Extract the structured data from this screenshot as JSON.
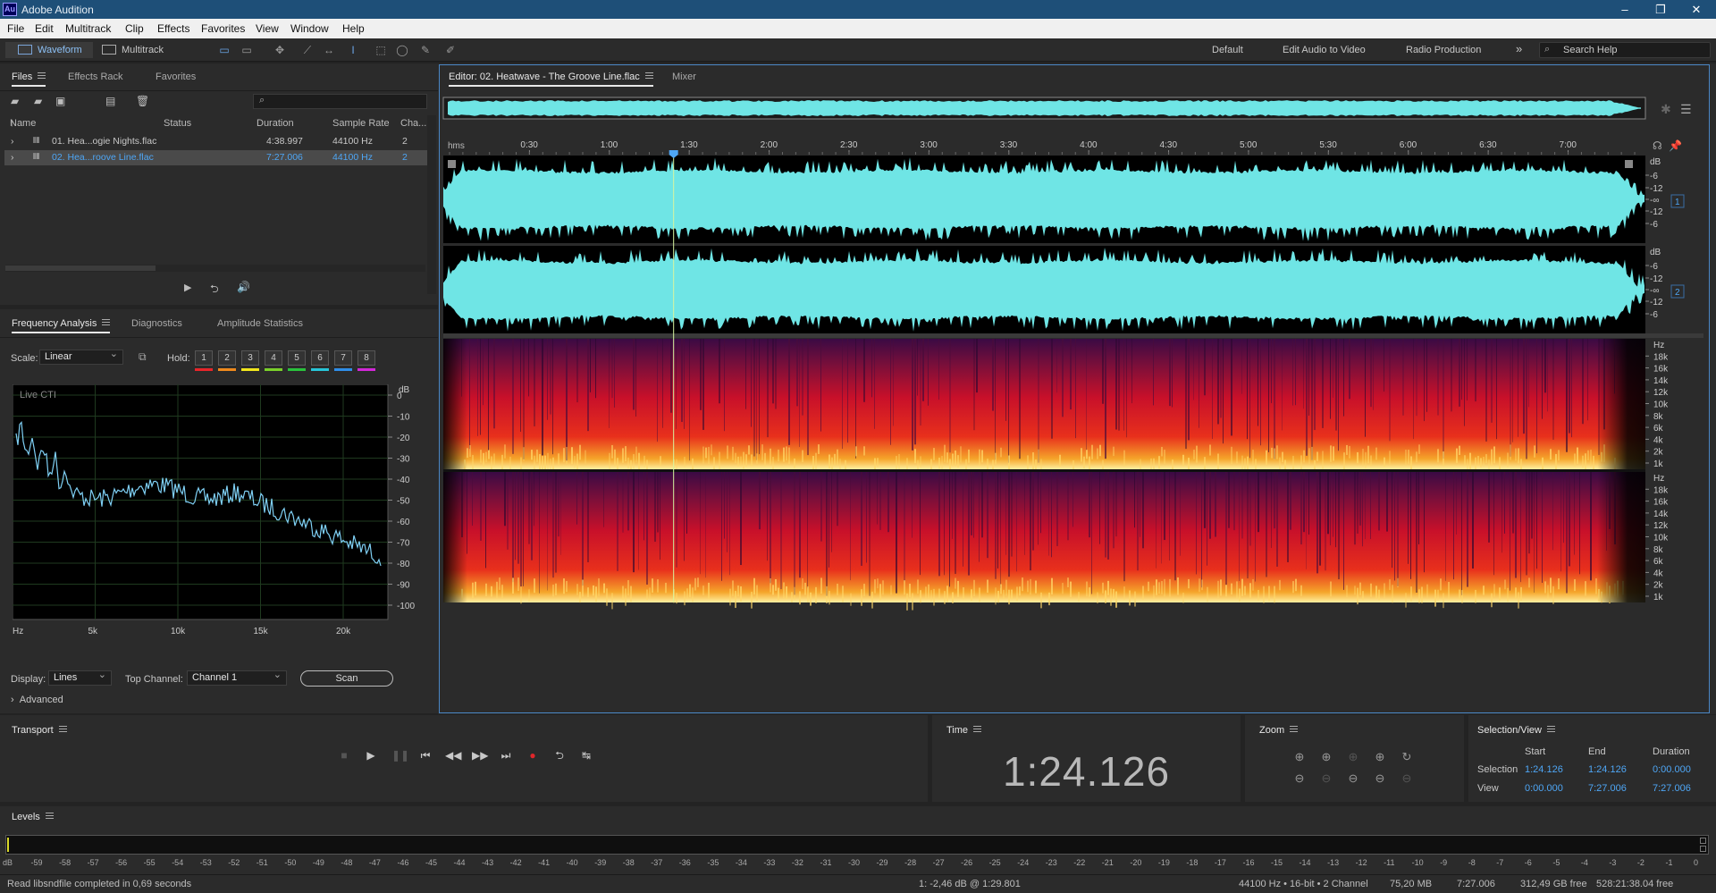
{
  "app": {
    "title": "Adobe Audition",
    "logo": "Au"
  },
  "menu": [
    "File",
    "Edit",
    "Multitrack",
    "Clip",
    "Effects",
    "Favorites",
    "View",
    "Window",
    "Help"
  ],
  "toolbar": {
    "waveform": "Waveform",
    "multitrack": "Multitrack",
    "workspaces": [
      "Default",
      "Edit Audio to Video",
      "Radio Production"
    ],
    "more": "»",
    "search_placeholder": "Search Help"
  },
  "files_panel": {
    "tabs": [
      "Files",
      "Effects Rack",
      "Favorites"
    ],
    "columns": [
      "Name",
      "Status",
      "Duration",
      "Sample Rate",
      "Cha..."
    ],
    "rows": [
      {
        "name": "01. Hea...ogie Nights.flac",
        "duration": "4:38.997",
        "rate": "44100 Hz",
        "channels": "2"
      },
      {
        "name": "02. Hea...roove Line.flac",
        "duration": "7:27.006",
        "rate": "44100 Hz",
        "channels": "2"
      }
    ]
  },
  "freq_panel": {
    "tabs": [
      "Frequency Analysis",
      "Diagnostics",
      "Amplitude Statistics"
    ],
    "scale_label": "Scale:",
    "scale_value": "Linear",
    "hold_label": "Hold:",
    "hold": [
      "1",
      "2",
      "3",
      "4",
      "5",
      "6",
      "7",
      "8"
    ],
    "hold_colors": [
      "#e8252a",
      "#f08a1c",
      "#f2e61c",
      "#7ad02a",
      "#29c23c",
      "#27c5d8",
      "#2f8ee8",
      "#d227d8"
    ],
    "graph_label": "Live CTI",
    "db_label": "dB",
    "db_ticks": [
      "0",
      "-10",
      "-20",
      "-30",
      "-40",
      "-50",
      "-60",
      "-70",
      "-80",
      "-90",
      "-100"
    ],
    "hz_ticks": [
      "Hz",
      "5k",
      "10k",
      "15k",
      "20k"
    ],
    "display_label": "Display:",
    "display_value": "Lines",
    "top_channel_label": "Top Channel:",
    "top_channel_value": "Channel 1",
    "scan_label": "Scan",
    "advanced_label": "Advanced"
  },
  "editor": {
    "tab": "Editor: 02. Heatwave - The Groove Line.flac",
    "mixer": "Mixer",
    "ruler_unit": "hms",
    "ruler": [
      "0:30",
      "1:00",
      "1:30",
      "2:00",
      "2:30",
      "3:00",
      "3:30",
      "4:00",
      "4:30",
      "5:00",
      "5:30",
      "6:00",
      "6:30",
      "7:00"
    ],
    "db_ticks": [
      "dB",
      "-6",
      "-12",
      "-∞",
      "-12",
      "-6"
    ],
    "channel_labels": [
      "1",
      "2"
    ],
    "hz_ticks_1": [
      "Hz",
      "18k",
      "16k",
      "14k",
      "12k",
      "10k",
      "8k",
      "6k",
      "4k",
      "2k",
      "1k"
    ],
    "hz_ticks_2": [
      "Hz",
      "18k",
      "16k",
      "14k",
      "12k",
      "10k",
      "8k",
      "6k",
      "4k",
      "2k",
      "1k"
    ],
    "wave_color": "#6fe5e5"
  },
  "transport": {
    "title": "Transport"
  },
  "time_panel": {
    "title": "Time",
    "value": "1:24.126"
  },
  "zoom_panel": {
    "title": "Zoom"
  },
  "selview": {
    "title": "Selection/View",
    "cols": [
      "Start",
      "End",
      "Duration"
    ],
    "selection_label": "Selection",
    "selection": [
      "1:24.126",
      "1:24.126",
      "0:00.000"
    ],
    "view_label": "View",
    "view": [
      "0:00.000",
      "7:27.006",
      "7:27.006"
    ]
  },
  "levels": {
    "title": "Levels",
    "scale": [
      "dB",
      "-59",
      "-58",
      "-57",
      "-56",
      "-55",
      "-54",
      "-53",
      "-52",
      "-51",
      "-50",
      "-49",
      "-48",
      "-47",
      "-46",
      "-45",
      "-44",
      "-43",
      "-42",
      "-41",
      "-40",
      "-39",
      "-38",
      "-37",
      "-36",
      "-35",
      "-34",
      "-33",
      "-32",
      "-31",
      "-30",
      "-29",
      "-28",
      "-27",
      "-26",
      "-25",
      "-24",
      "-23",
      "-22",
      "-21",
      "-20",
      "-19",
      "-18",
      "-17",
      "-16",
      "-15",
      "-14",
      "-13",
      "-12",
      "-11",
      "-10",
      "-9",
      "-8",
      "-7",
      "-6",
      "-5",
      "-4",
      "-3",
      "-2",
      "-1",
      "0"
    ]
  },
  "status": {
    "message": "Read libsndfile completed in 0,69 seconds",
    "cursor": "1: -2,46 dB @ 1:29.801",
    "format": "44100 Hz • 16-bit • 2 Channel",
    "size": "75,20 MB",
    "duration": "7:27.006",
    "free": "312,49 GB free",
    "free_time": "528:21:38.04 free"
  }
}
